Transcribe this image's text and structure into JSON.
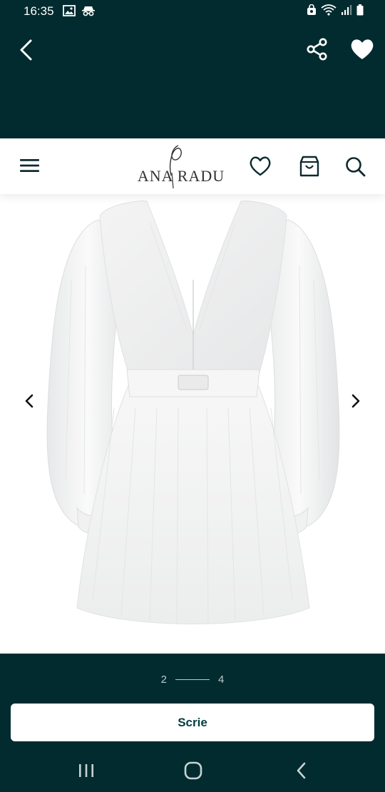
{
  "status_bar": {
    "time": "16:35"
  },
  "app_bar": {
    "back": "back-icon",
    "share": "share-icon",
    "favorite": "heart-filled-icon"
  },
  "site_header": {
    "logo_text": "ANA RADU",
    "icons": [
      "menu-icon",
      "heart-outline-icon",
      "shopping-bag-icon",
      "search-icon"
    ]
  },
  "gallery": {
    "current": "2",
    "total": "4"
  },
  "cta": {
    "label": "Scrie"
  },
  "colors": {
    "background": "#022b2f",
    "cta_text": "#033d43",
    "pager": "#b8c9cb"
  }
}
